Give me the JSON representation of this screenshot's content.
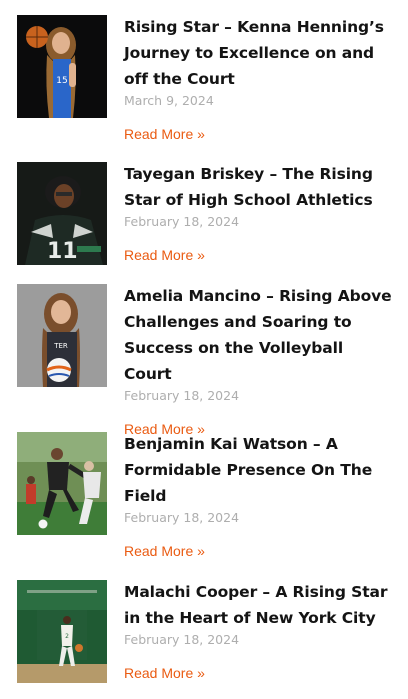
{
  "posts": [
    {
      "title": "Rising Star – Kenna Henning’s Journey to Excellence on and off the Court",
      "date": "March 9, 2024",
      "read_more": "Read More »",
      "image_icon": "basketball-player-photo"
    },
    {
      "title": "Tayegan Briskey – The Rising Star of High School Athletics",
      "date": "February 18, 2024",
      "read_more": "Read More »",
      "image_icon": "football-player-photo"
    },
    {
      "title": "Amelia Mancino – Rising Above Challenges and Soaring to Success on the Volleyball Court",
      "date": "February 18, 2024",
      "read_more": "Read More »",
      "image_icon": "volleyball-player-photo"
    },
    {
      "title": "Benjamin Kai Watson – A Formidable Presence On The Field",
      "date": "February 18, 2024",
      "read_more": "Read More »",
      "image_icon": "soccer-players-photo"
    },
    {
      "title": "Malachi Cooper – A Rising Star in the Heart of New York City",
      "date": "February 18, 2024",
      "read_more": "Read More »",
      "image_icon": "gym-basketball-photo"
    }
  ],
  "colors": {
    "title": "#141414",
    "date": "#aeaeae",
    "read_more": "#ea5b12"
  }
}
